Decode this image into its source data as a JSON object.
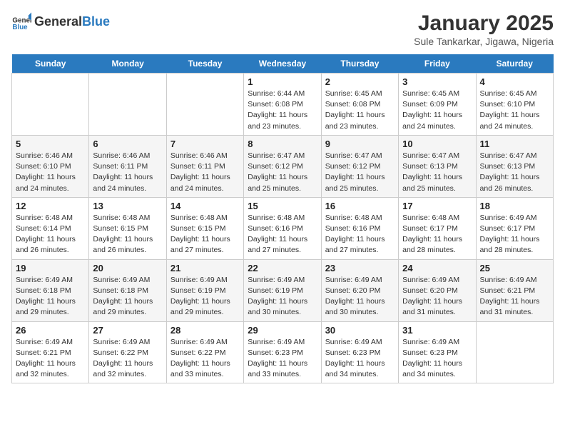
{
  "header": {
    "logo_general": "General",
    "logo_blue": "Blue",
    "title": "January 2025",
    "subtitle": "Sule Tankarkar, Jigawa, Nigeria"
  },
  "days": [
    "Sunday",
    "Monday",
    "Tuesday",
    "Wednesday",
    "Thursday",
    "Friday",
    "Saturday"
  ],
  "weeks": [
    [
      {
        "date": "",
        "info": ""
      },
      {
        "date": "",
        "info": ""
      },
      {
        "date": "",
        "info": ""
      },
      {
        "date": "1",
        "info": "Sunrise: 6:44 AM\nSunset: 6:08 PM\nDaylight: 11 hours and 23 minutes."
      },
      {
        "date": "2",
        "info": "Sunrise: 6:45 AM\nSunset: 6:08 PM\nDaylight: 11 hours and 23 minutes."
      },
      {
        "date": "3",
        "info": "Sunrise: 6:45 AM\nSunset: 6:09 PM\nDaylight: 11 hours and 24 minutes."
      },
      {
        "date": "4",
        "info": "Sunrise: 6:45 AM\nSunset: 6:10 PM\nDaylight: 11 hours and 24 minutes."
      }
    ],
    [
      {
        "date": "5",
        "info": "Sunrise: 6:46 AM\nSunset: 6:10 PM\nDaylight: 11 hours and 24 minutes."
      },
      {
        "date": "6",
        "info": "Sunrise: 6:46 AM\nSunset: 6:11 PM\nDaylight: 11 hours and 24 minutes."
      },
      {
        "date": "7",
        "info": "Sunrise: 6:46 AM\nSunset: 6:11 PM\nDaylight: 11 hours and 24 minutes."
      },
      {
        "date": "8",
        "info": "Sunrise: 6:47 AM\nSunset: 6:12 PM\nDaylight: 11 hours and 25 minutes."
      },
      {
        "date": "9",
        "info": "Sunrise: 6:47 AM\nSunset: 6:12 PM\nDaylight: 11 hours and 25 minutes."
      },
      {
        "date": "10",
        "info": "Sunrise: 6:47 AM\nSunset: 6:13 PM\nDaylight: 11 hours and 25 minutes."
      },
      {
        "date": "11",
        "info": "Sunrise: 6:47 AM\nSunset: 6:13 PM\nDaylight: 11 hours and 26 minutes."
      }
    ],
    [
      {
        "date": "12",
        "info": "Sunrise: 6:48 AM\nSunset: 6:14 PM\nDaylight: 11 hours and 26 minutes."
      },
      {
        "date": "13",
        "info": "Sunrise: 6:48 AM\nSunset: 6:15 PM\nDaylight: 11 hours and 26 minutes."
      },
      {
        "date": "14",
        "info": "Sunrise: 6:48 AM\nSunset: 6:15 PM\nDaylight: 11 hours and 27 minutes."
      },
      {
        "date": "15",
        "info": "Sunrise: 6:48 AM\nSunset: 6:16 PM\nDaylight: 11 hours and 27 minutes."
      },
      {
        "date": "16",
        "info": "Sunrise: 6:48 AM\nSunset: 6:16 PM\nDaylight: 11 hours and 27 minutes."
      },
      {
        "date": "17",
        "info": "Sunrise: 6:48 AM\nSunset: 6:17 PM\nDaylight: 11 hours and 28 minutes."
      },
      {
        "date": "18",
        "info": "Sunrise: 6:49 AM\nSunset: 6:17 PM\nDaylight: 11 hours and 28 minutes."
      }
    ],
    [
      {
        "date": "19",
        "info": "Sunrise: 6:49 AM\nSunset: 6:18 PM\nDaylight: 11 hours and 29 minutes."
      },
      {
        "date": "20",
        "info": "Sunrise: 6:49 AM\nSunset: 6:18 PM\nDaylight: 11 hours and 29 minutes."
      },
      {
        "date": "21",
        "info": "Sunrise: 6:49 AM\nSunset: 6:19 PM\nDaylight: 11 hours and 29 minutes."
      },
      {
        "date": "22",
        "info": "Sunrise: 6:49 AM\nSunset: 6:19 PM\nDaylight: 11 hours and 30 minutes."
      },
      {
        "date": "23",
        "info": "Sunrise: 6:49 AM\nSunset: 6:20 PM\nDaylight: 11 hours and 30 minutes."
      },
      {
        "date": "24",
        "info": "Sunrise: 6:49 AM\nSunset: 6:20 PM\nDaylight: 11 hours and 31 minutes."
      },
      {
        "date": "25",
        "info": "Sunrise: 6:49 AM\nSunset: 6:21 PM\nDaylight: 11 hours and 31 minutes."
      }
    ],
    [
      {
        "date": "26",
        "info": "Sunrise: 6:49 AM\nSunset: 6:21 PM\nDaylight: 11 hours and 32 minutes."
      },
      {
        "date": "27",
        "info": "Sunrise: 6:49 AM\nSunset: 6:22 PM\nDaylight: 11 hours and 32 minutes."
      },
      {
        "date": "28",
        "info": "Sunrise: 6:49 AM\nSunset: 6:22 PM\nDaylight: 11 hours and 33 minutes."
      },
      {
        "date": "29",
        "info": "Sunrise: 6:49 AM\nSunset: 6:23 PM\nDaylight: 11 hours and 33 minutes."
      },
      {
        "date": "30",
        "info": "Sunrise: 6:49 AM\nSunset: 6:23 PM\nDaylight: 11 hours and 34 minutes."
      },
      {
        "date": "31",
        "info": "Sunrise: 6:49 AM\nSunset: 6:23 PM\nDaylight: 11 hours and 34 minutes."
      },
      {
        "date": "",
        "info": ""
      }
    ]
  ]
}
